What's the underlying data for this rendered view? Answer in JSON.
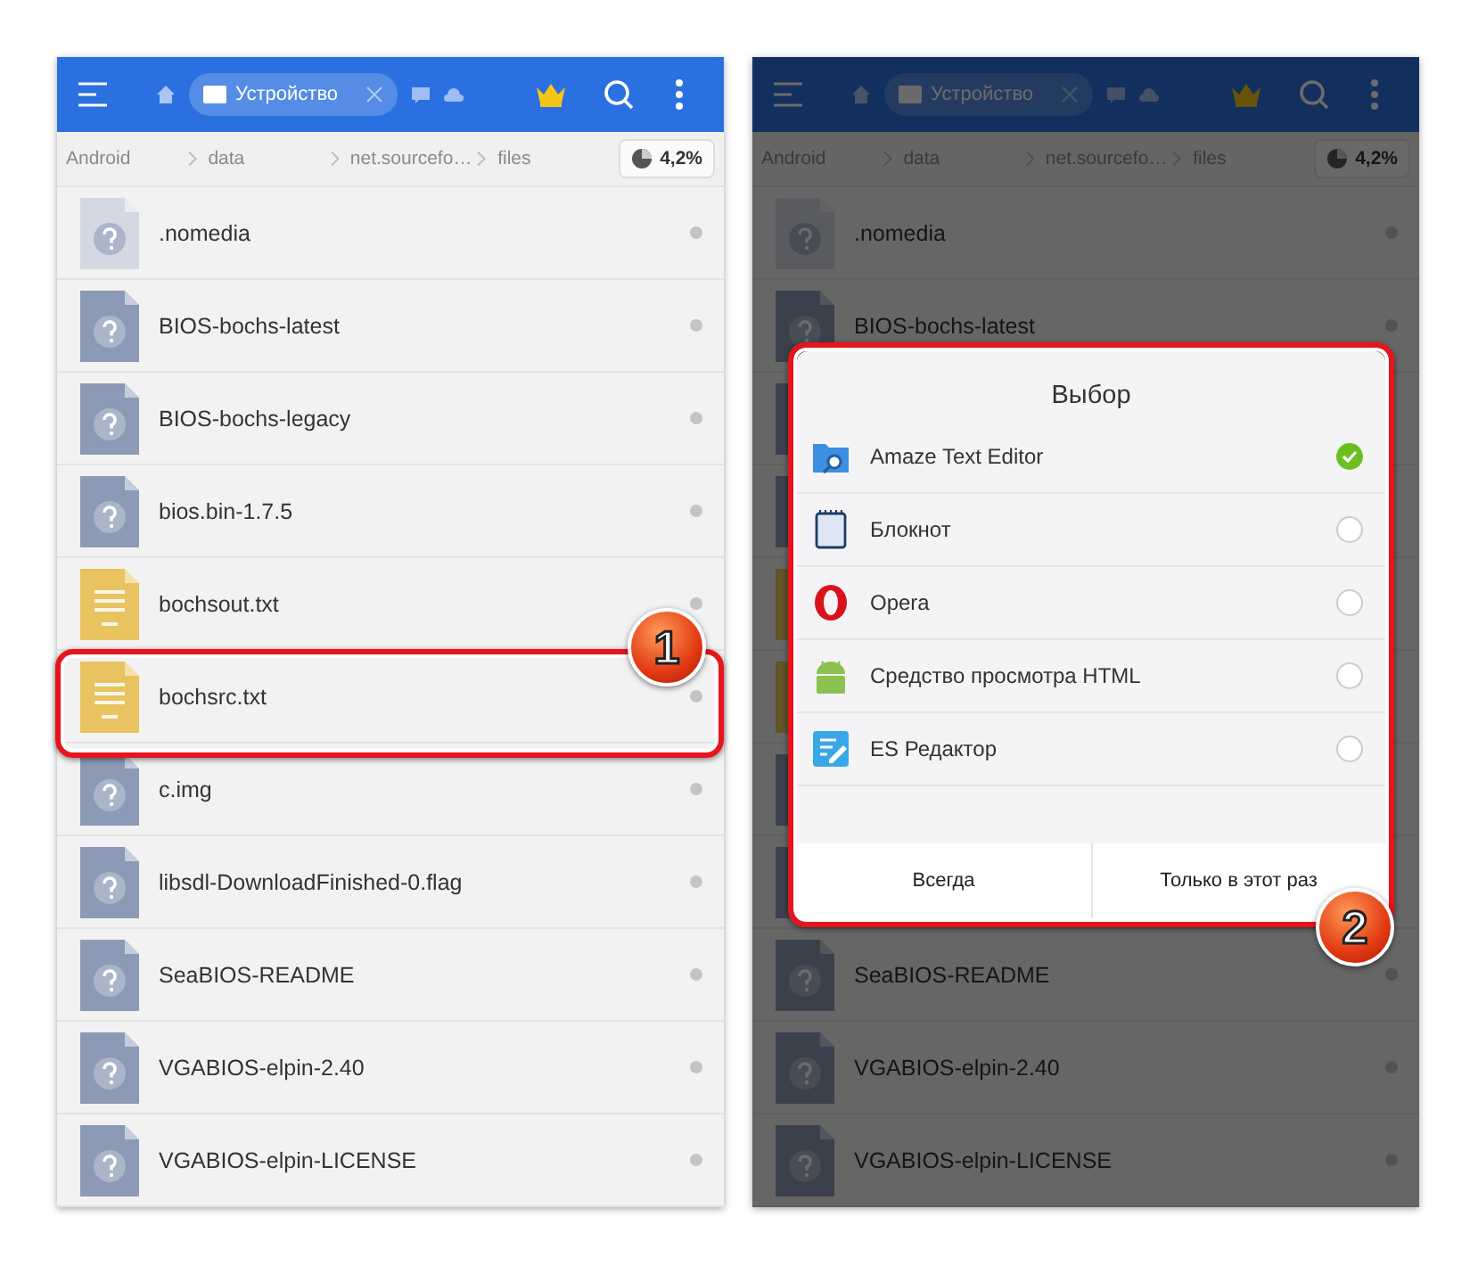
{
  "screens": [
    {
      "dimmed": false,
      "toolbar": {
        "tab": "Устройство"
      },
      "breadcrumbs": [
        "Android",
        "data",
        "net.sourcefo…",
        "files"
      ],
      "storage": "4,2%",
      "files": [
        {
          "kind": "unknown",
          "name": ".nomedia",
          "hidden": true
        },
        {
          "kind": "unknown",
          "name": "BIOS-bochs-latest",
          "hidden": false
        },
        {
          "kind": "unknown",
          "name": "BIOS-bochs-legacy",
          "hidden": false
        },
        {
          "kind": "unknown",
          "name": "bios.bin-1.7.5",
          "hidden": false
        },
        {
          "kind": "text",
          "name": "bochsout.txt",
          "hidden": false
        },
        {
          "kind": "text",
          "name": "bochsrc.txt",
          "hidden": false,
          "callout": "1"
        },
        {
          "kind": "unknown",
          "name": "c.img",
          "hidden": false
        },
        {
          "kind": "unknown",
          "name": "libsdl-DownloadFinished-0.flag",
          "hidden": false
        },
        {
          "kind": "unknown",
          "name": "SeaBIOS-README",
          "hidden": false
        },
        {
          "kind": "unknown",
          "name": "VGABIOS-elpin-2.40",
          "hidden": false
        },
        {
          "kind": "unknown",
          "name": "VGABIOS-elpin-LICENSE",
          "hidden": false
        }
      ]
    },
    {
      "dimmed": true,
      "toolbar": {
        "tab": "Устройство"
      },
      "breadcrumbs": [
        "Android",
        "data",
        "net.sourcefo…",
        "files"
      ],
      "storage": "4,2%",
      "files": [
        {
          "kind": "unknown",
          "name": ".nomedia",
          "hidden": true
        },
        {
          "kind": "unknown",
          "name": "BIOS-bochs-latest",
          "hidden": false
        },
        {
          "kind": "unknown",
          "hidden": false
        },
        {
          "kind": "unknown",
          "hidden": false
        },
        {
          "kind": "text",
          "hidden": false
        },
        {
          "kind": "text",
          "hidden": false
        },
        {
          "kind": "unknown",
          "hidden": false
        },
        {
          "kind": "unknown",
          "hidden": false
        },
        {
          "kind": "unknown",
          "name": "SeaBIOS-README",
          "hidden": false
        },
        {
          "kind": "unknown",
          "name": "VGABIOS-elpin-2.40",
          "hidden": false
        },
        {
          "kind": "unknown",
          "name": "VGABIOS-elpin-LICENSE",
          "hidden": false
        }
      ],
      "dialog": {
        "title": "Выбор",
        "callout": "2",
        "apps": [
          {
            "kind": "folder",
            "name": "Amaze Text Editor",
            "selected": true
          },
          {
            "kind": "notepad",
            "name": "Блокнот",
            "selected": false
          },
          {
            "kind": "opera",
            "name": "Opera",
            "selected": false
          },
          {
            "kind": "android",
            "name": "Средство просмотра HTML",
            "selected": false
          },
          {
            "kind": "editor",
            "name": "ES Редактор",
            "selected": false
          }
        ],
        "buttons": [
          "Всегда",
          "Только в этот раз"
        ]
      }
    }
  ]
}
